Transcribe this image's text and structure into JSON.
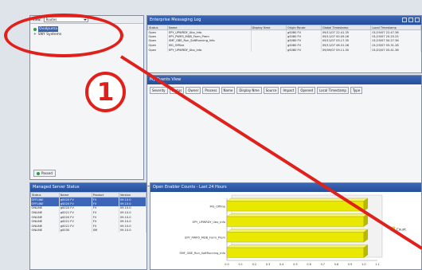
{
  "explorer": {
    "view_label": "View:",
    "view_value": "Routes",
    "tree": [
      {
        "label": "Ovalpuma",
        "selected": true
      },
      {
        "label": "SNY Systems",
        "selected": false
      }
    ],
    "status_button": "Passed"
  },
  "messaging": {
    "title": "Enterprise Messaging Log",
    "columns": [
      "Status",
      "Name",
      "Display Nme",
      "Origin Route",
      "Global Timestamp",
      "Local Timestamp"
    ],
    "rows": [
      [
        "Open",
        "EPY_UPWRDY_Ubx_Info",
        "",
        "gS080 FV",
        "09/11/07 22.41.35",
        "01/19/07 22.47.36"
      ],
      [
        "Open",
        "EPY_PWR5_MDB_Form_Prem",
        "",
        "gS080 FV",
        "09/11/07 00.09.26",
        "01/19/07 20.20.25"
      ],
      [
        "Open",
        "SMF_GBE_Run_SoftRunning_Info",
        "",
        "gS080 FV",
        "09/11/07 03.17.35",
        "01/19/07 00.27.36"
      ],
      [
        "Open",
        "MG_Offline",
        "",
        "gS080 FV",
        "09/11/07 06.31.28",
        "01/19/07 05.31.28"
      ],
      [
        "Open",
        "EPY_UPWRDY_Ubx_Info",
        "",
        "gS080 FV",
        "09/09/07 09.11.35",
        "01/20/07 05.41.36"
      ]
    ]
  },
  "my_events": {
    "title": "My Events View",
    "columns": [
      "Severity",
      "Status",
      "Owner",
      "Process",
      "Name",
      "Display Nme",
      "Source",
      "Impact",
      "Opened",
      "Local Timestamp",
      "Type"
    ]
  },
  "managed_nodes": {
    "title": "Managed Server Status",
    "columns": [
      "Status",
      "Name",
      "Product",
      "Version"
    ],
    "rows": [
      [
        "OFFLINE",
        "gS020 FV",
        "FV",
        "09.10.0"
      ],
      [
        "OFFLINE",
        "gS020 FV",
        "FV",
        "09.10.0"
      ],
      [
        "ONLINE",
        "gS020 FV",
        "FV",
        "09.10.0"
      ],
      [
        "ONLINE",
        "gS021 FV",
        "FV",
        "09.10.0"
      ],
      [
        "ONLINE",
        "gS020 FV",
        "FV",
        "09.10.0"
      ],
      [
        "ONLINE",
        "gS021 FV",
        "FV",
        "09.10.0"
      ],
      [
        "ONLINE",
        "gS021 FV",
        "FV",
        "09.10.0"
      ],
      [
        "ONLINE",
        "gS030",
        "SM",
        "09.10.0"
      ]
    ]
  },
  "chart_panel": {
    "title": "Open Enabler Counts - Last 24 Hours",
    "legend": "Count"
  },
  "chart_data": {
    "type": "bar",
    "orientation": "horizontal",
    "categories": [
      "MG_Offline",
      "EPY_UPWRDY_Ubx_Info",
      "EPY_PWR5_MDB_Form_Prem",
      "SMF_GBE_Run_SoftRunning_Info"
    ],
    "values": [
      1,
      1,
      1,
      1
    ],
    "xlim": [
      0,
      1.1
    ],
    "x_ticks": [
      "0.0",
      "0.1",
      "0.2",
      "0.3",
      "0.4",
      "0.5",
      "0.6",
      "0.7",
      "0.8",
      "0.9",
      "1.0",
      "1.1"
    ],
    "series": [
      {
        "name": "Count",
        "values": [
          1,
          1,
          1,
          1
        ]
      }
    ],
    "bar_color": "#e8e800",
    "legend_position": "right",
    "grid": false
  },
  "callout": {
    "number": "1",
    "color": "#e0201b"
  }
}
